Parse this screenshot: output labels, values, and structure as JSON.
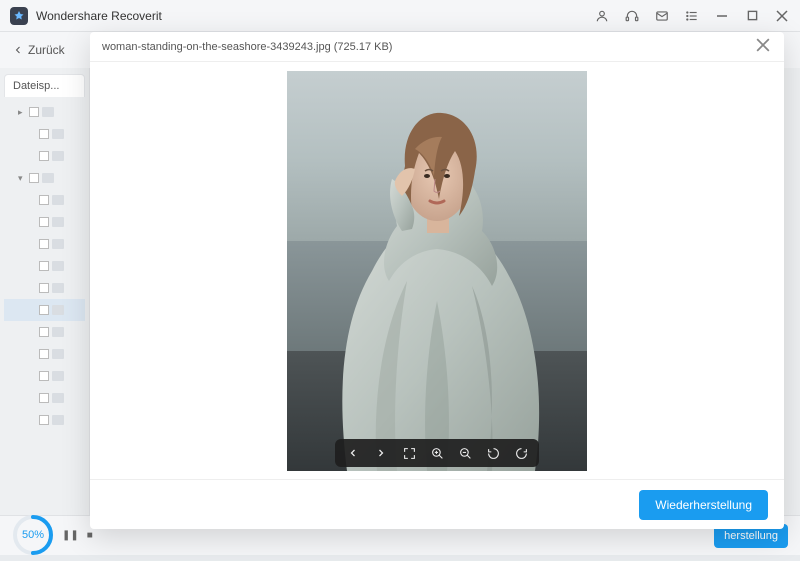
{
  "app": {
    "title": "Wondershare Recoverit"
  },
  "toolbar": {
    "back_label": "Zurück"
  },
  "sidebar": {
    "tab_label": "Dateisp..."
  },
  "progress": {
    "percent_label": "50",
    "percent_value": 50
  },
  "bottom": {
    "recover_label": "herstellung"
  },
  "preview": {
    "filename": "woman-standing-on-the-seashore-3439243.jpg",
    "filesize": "(725.17 KB)",
    "recover_label": "Wiederherstellung"
  }
}
